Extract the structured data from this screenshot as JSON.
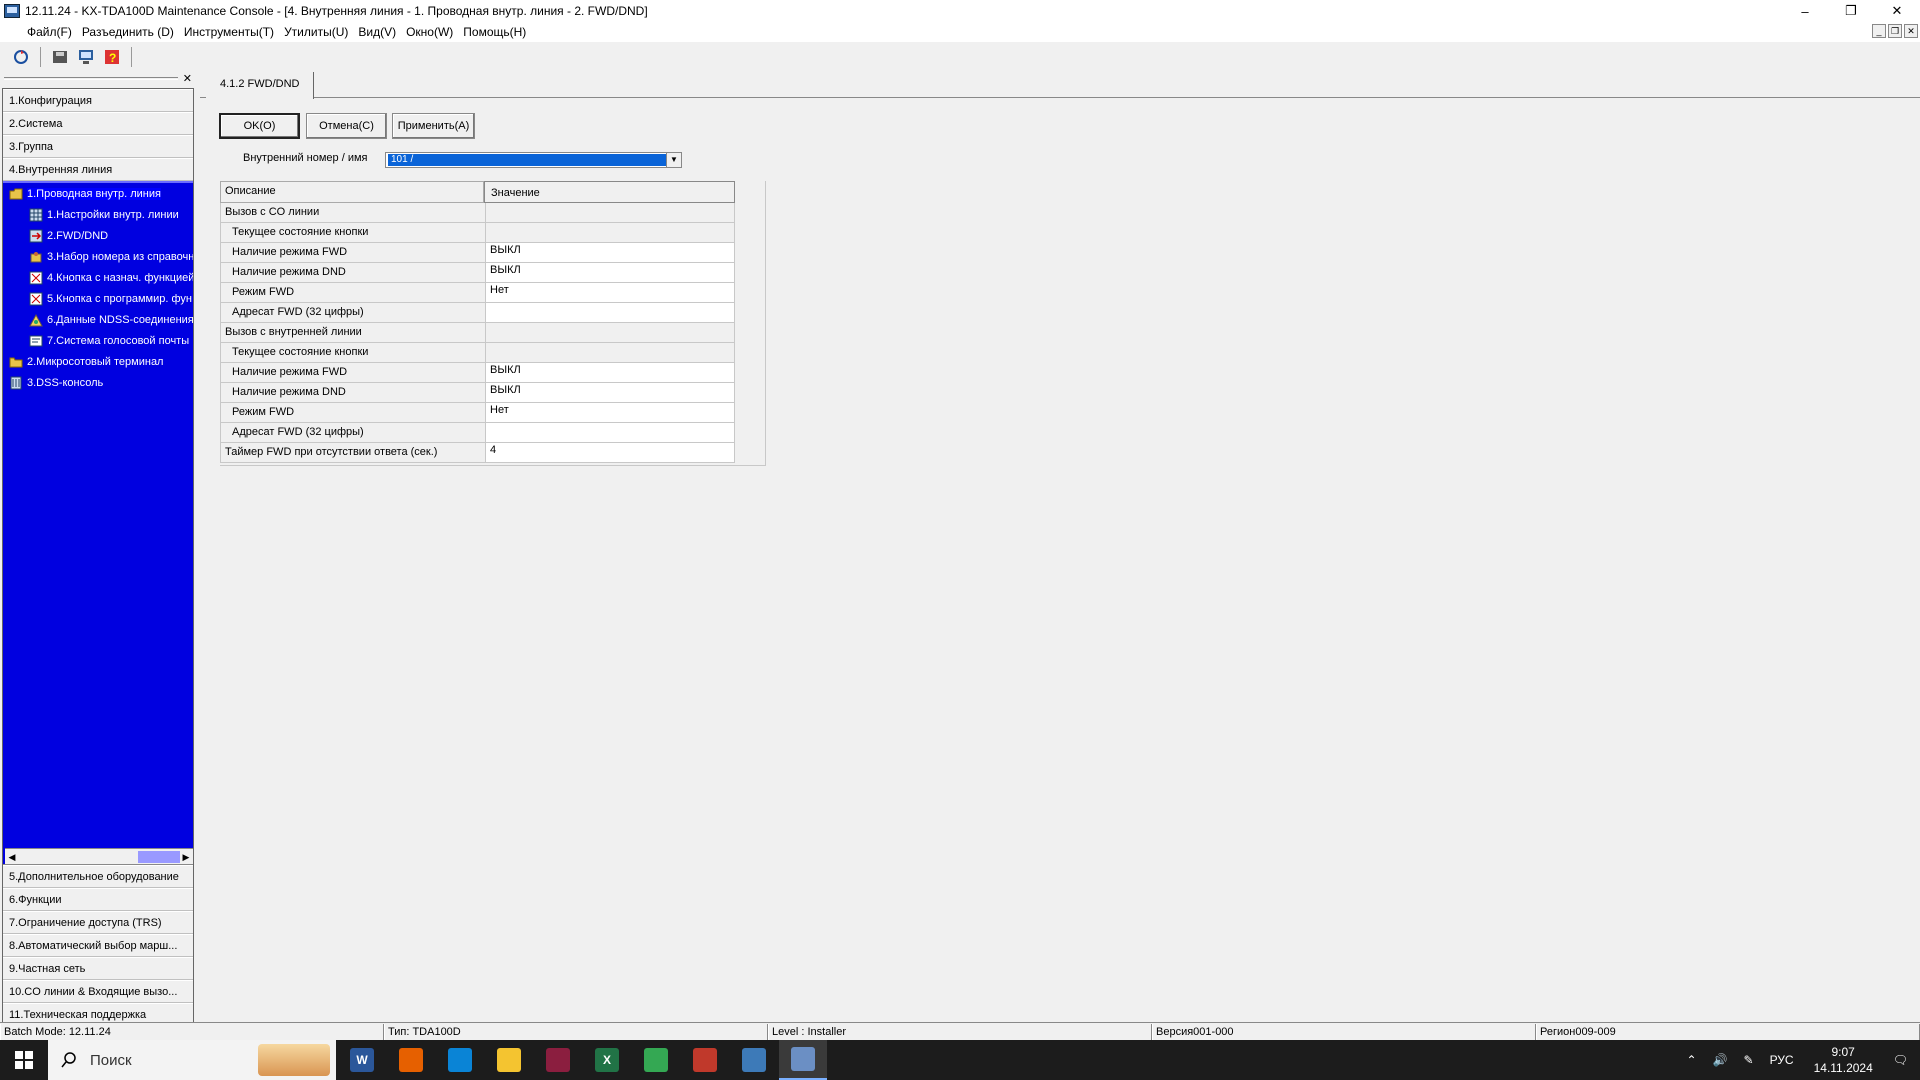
{
  "window": {
    "title": "12.11.24 - KX-TDA100D Maintenance Console - [4. Внутренняя линия - 1. Проводная внутр. линия - 2. FWD/DND]",
    "controls": {
      "minimize": "–",
      "restore": "❐",
      "close": "✕"
    }
  },
  "menubar": {
    "items": [
      "Файл(F)",
      "Разъединить (D)",
      "Инструменты(T)",
      "Утилиты(U)",
      "Вид(V)",
      "Окно(W)",
      "Помощь(H)"
    ]
  },
  "nav": {
    "top_categories": [
      "1.Конфигурация",
      "2.Система",
      "3.Группа",
      "4.Внутренняя линия"
    ],
    "tree": [
      {
        "label": "1.Проводная внутр. линия",
        "icon": "folder-open-icon"
      },
      {
        "label": "1.Настройки внутр. линии",
        "icon": "grid-icon"
      },
      {
        "label": "2.FWD/DND",
        "icon": "forward-icon"
      },
      {
        "label": "3.Набор номера из справочн",
        "icon": "phonebook-icon"
      },
      {
        "label": "4.Кнопка с назнач. функцией",
        "icon": "button-icon"
      },
      {
        "label": "5.Кнопка с программир. фун",
        "icon": "button-icon"
      },
      {
        "label": "6.Данные NDSS-соединения",
        "icon": "network-icon"
      },
      {
        "label": "7.Система голосовой почты",
        "icon": "voicemail-icon"
      },
      {
        "label": "2.Микросотовый терминал",
        "icon": "folder-icon"
      },
      {
        "label": "3.DSS-консоль",
        "icon": "console-icon"
      }
    ],
    "bottom_categories": [
      "5.Дополнительное оборудование",
      "6.Функции",
      "7.Ограничение доступа (TRS)",
      "8.Автоматический выбор марш...",
      "9.Частная сеть",
      "10.CO линии & Входящие вызо...",
      "11.Техническая поддержка"
    ]
  },
  "content": {
    "tab_label": "4.1.2 FWD/DND",
    "buttons": {
      "ok": "OK(O)",
      "cancel": "Отмена(C)",
      "apply": "Применить(A)"
    },
    "extension_label": "Внутренний номер / имя",
    "extension_value": "101 /",
    "grid": {
      "col_desc": "Описание",
      "col_value": "Значение",
      "rows": [
        {
          "desc": "Вызов с CO линии",
          "value": "",
          "indent": false,
          "editable": false
        },
        {
          "desc": "Текущее состояние кнопки",
          "value": "",
          "indent": true,
          "editable": false
        },
        {
          "desc": "Наличие режима FWD",
          "value": "ВЫКЛ",
          "indent": true,
          "editable": true
        },
        {
          "desc": "Наличие режима DND",
          "value": "ВЫКЛ",
          "indent": true,
          "editable": true
        },
        {
          "desc": "Режим FWD",
          "value": "Нет",
          "indent": true,
          "editable": true
        },
        {
          "desc": "Адресат FWD (32 цифры)",
          "value": "",
          "indent": true,
          "editable": true
        },
        {
          "desc": "Вызов с внутренней линии",
          "value": "",
          "indent": false,
          "editable": false
        },
        {
          "desc": "Текущее состояние кнопки",
          "value": "",
          "indent": true,
          "editable": false
        },
        {
          "desc": "Наличие режима FWD",
          "value": "ВЫКЛ",
          "indent": true,
          "editable": true
        },
        {
          "desc": "Наличие режима DND",
          "value": "ВЫКЛ",
          "indent": true,
          "editable": true
        },
        {
          "desc": "Режим FWD",
          "value": "Нет",
          "indent": true,
          "editable": true
        },
        {
          "desc": "Адресат FWD (32 цифры)",
          "value": "",
          "indent": true,
          "editable": true
        },
        {
          "desc": "Таймер FWD при отсутствии ответа (сек.)",
          "value": "4",
          "indent": false,
          "editable": true
        }
      ]
    }
  },
  "statusbar": {
    "batch": "Batch Mode: 12.11.24",
    "type": "Тип: TDA100D",
    "level": "Level : Installer",
    "version": "Версия001-000",
    "region": "Регион009-009"
  },
  "taskbar": {
    "search_placeholder": "Поиск",
    "language": "РУС",
    "time": "9:07",
    "date": "14.11.2024",
    "apps": [
      {
        "name": "word",
        "color": "#2b579a",
        "glyph": "W"
      },
      {
        "name": "firefox",
        "color": "#e66000",
        "glyph": ""
      },
      {
        "name": "edge",
        "color": "#0a84d6",
        "glyph": ""
      },
      {
        "name": "explorer",
        "color": "#f4c430",
        "glyph": ""
      },
      {
        "name": "winrar",
        "color": "#8b1e3f",
        "glyph": ""
      },
      {
        "name": "excel",
        "color": "#217346",
        "glyph": "X"
      },
      {
        "name": "chrome",
        "color": "#34a853",
        "glyph": ""
      },
      {
        "name": "app",
        "color": "#c0392b",
        "glyph": ""
      },
      {
        "name": "paint",
        "color": "#3d7ab8",
        "glyph": ""
      },
      {
        "name": "maintenance-console",
        "color": "#6b8fc4",
        "glyph": ""
      }
    ]
  }
}
